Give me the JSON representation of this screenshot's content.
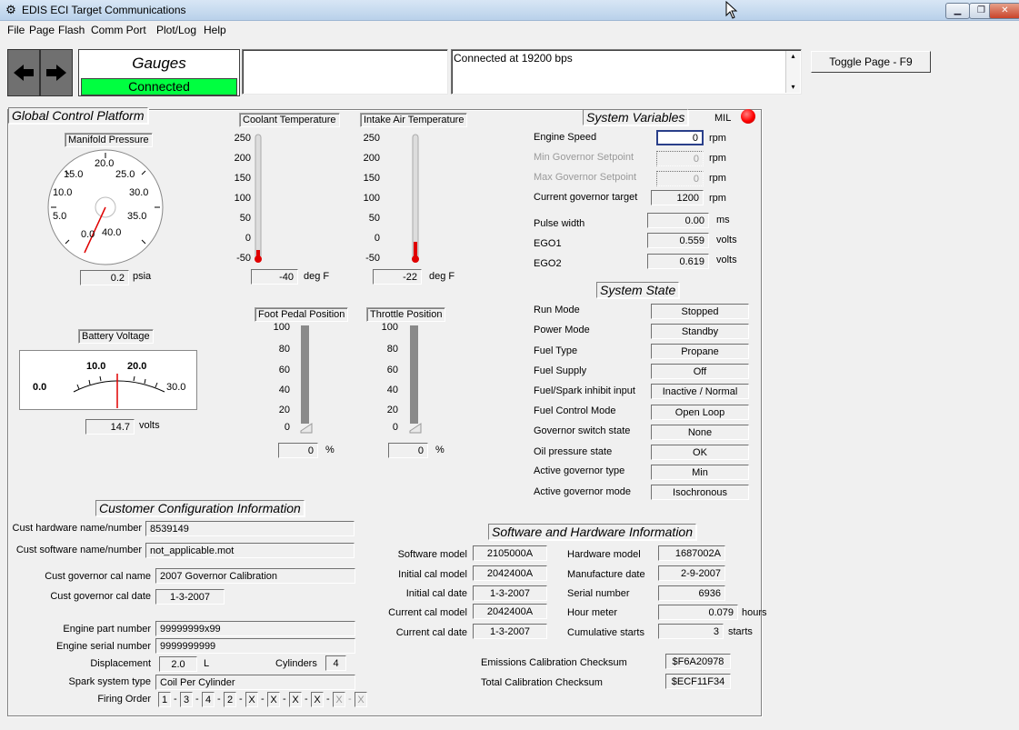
{
  "window": {
    "title": "EDIS ECI Target Communications"
  },
  "menu": [
    "File",
    "Page",
    "Flash",
    "Comm Port",
    "Plot/Log",
    "Help"
  ],
  "toolbar": {
    "page_name": "Gauges",
    "connection_status": "Connected",
    "status_message": "Connected at 19200 bps",
    "toggle_button": "Toggle Page - F9"
  },
  "colors": {
    "connected_green": "#00ff40",
    "mil_red": "#ff0000",
    "needle_red": "#e00000"
  },
  "global": {
    "title": "Global Control Platform",
    "manifold": {
      "label": "Manifold Pressure",
      "scale": [
        "5.0",
        "10.0",
        "15.0",
        "20.0",
        "25.0",
        "30.0",
        "35.0",
        "40.0",
        "0.0"
      ],
      "value": "0.2",
      "unit": "psia"
    },
    "battery": {
      "label": "Battery Voltage",
      "scale": [
        "0.0",
        "10.0",
        "20.0",
        "30.0"
      ],
      "value": "14.7",
      "unit": "volts"
    },
    "coolant": {
      "label": "Coolant Temperature",
      "ticks": [
        "250",
        "200",
        "150",
        "100",
        "50",
        "0",
        "-50"
      ],
      "value": "-40",
      "unit": "deg F"
    },
    "intake": {
      "label": "Intake Air Temperature",
      "ticks": [
        "250",
        "200",
        "150",
        "100",
        "50",
        "0",
        "-50"
      ],
      "value": "-22",
      "unit": "deg F"
    },
    "pedal": {
      "label": "Foot Pedal Position",
      "ticks": [
        "100",
        "80",
        "60",
        "40",
        "20",
        "0"
      ],
      "value": "0",
      "unit": "%"
    },
    "throttle": {
      "label": "Throttle Position",
      "ticks": [
        "100",
        "80",
        "60",
        "40",
        "20",
        "0"
      ],
      "value": "0",
      "unit": "%"
    }
  },
  "sysvars": {
    "title": "System Variables",
    "mil": "MIL",
    "rows": [
      {
        "label": "Engine Speed",
        "value": "0",
        "unit": "rpm"
      },
      {
        "label": "Min Governor Setpoint",
        "value": "0",
        "unit": "rpm"
      },
      {
        "label": "Max Governor Setpoint",
        "value": "0",
        "unit": "rpm"
      },
      {
        "label": "Current governor target",
        "value": "1200",
        "unit": "rpm"
      },
      {
        "label": "Pulse width",
        "value": "0.00",
        "unit": "ms"
      },
      {
        "label": "EGO1",
        "value": "0.559",
        "unit": "volts"
      },
      {
        "label": "EGO2",
        "value": "0.619",
        "unit": "volts"
      }
    ]
  },
  "sysstate": {
    "title": "System State",
    "rows": [
      {
        "label": "Run Mode",
        "value": "Stopped"
      },
      {
        "label": "Power Mode",
        "value": "Standby"
      },
      {
        "label": "Fuel Type",
        "value": "Propane"
      },
      {
        "label": "Fuel Supply",
        "value": "Off"
      },
      {
        "label": "Fuel/Spark inhibit input",
        "value": "Inactive / Normal"
      },
      {
        "label": "Fuel Control Mode",
        "value": "Open Loop"
      },
      {
        "label": "Governor switch state",
        "value": "None"
      },
      {
        "label": "Oil pressure state",
        "value": "OK"
      },
      {
        "label": "Active governor type",
        "value": "Min"
      },
      {
        "label": "Active governor mode",
        "value": "Isochronous"
      }
    ]
  },
  "custconfig": {
    "title": "Customer Configuration Information",
    "hw_label": "Cust hardware name/number",
    "hw_value": "8539149",
    "sw_label": "Cust software name/number",
    "sw_value": "not_applicable.mot",
    "calname_label": "Cust governor cal name",
    "calname_value": "2007 Governor Calibration",
    "caldate_label": "Cust governor cal date",
    "caldate_value": "1-3-2007",
    "partnum_label": "Engine part number",
    "partnum_value": "99999999x99",
    "serial_label": "Engine serial number",
    "serial_value": "9999999999",
    "disp_label": "Displacement",
    "disp_value": "2.0",
    "disp_unit": "L",
    "cyl_label": "Cylinders",
    "cyl_value": "4",
    "spark_label": "Spark system type",
    "spark_value": "Coil Per Cylinder",
    "firing_label": "Firing Order",
    "firing": [
      "1",
      "3",
      "4",
      "2",
      "X",
      "X",
      "X",
      "X",
      "X",
      "X"
    ],
    "sep": "-"
  },
  "swhw": {
    "title": "Software and Hardware Information",
    "left": [
      {
        "label": "Software model",
        "value": "2105000A"
      },
      {
        "label": "Initial cal model",
        "value": "2042400A"
      },
      {
        "label": "Initial cal date",
        "value": "1-3-2007"
      },
      {
        "label": "Current cal model",
        "value": "2042400A"
      },
      {
        "label": "Current cal date",
        "value": "1-3-2007"
      }
    ],
    "right": [
      {
        "label": "Hardware model",
        "value": "1687002A",
        "unit": ""
      },
      {
        "label": "Manufacture date",
        "value": "2-9-2007",
        "unit": ""
      },
      {
        "label": "Serial number",
        "value": "6936",
        "unit": ""
      },
      {
        "label": "Hour meter",
        "value": "0.079",
        "unit": "hours"
      },
      {
        "label": "Cumulative starts",
        "value": "3",
        "unit": "starts"
      }
    ],
    "emis_label": "Emissions Calibration Checksum",
    "emis_value": "$F6A20978",
    "total_label": "Total Calibration Checksum",
    "total_value": "$ECF11F34"
  }
}
